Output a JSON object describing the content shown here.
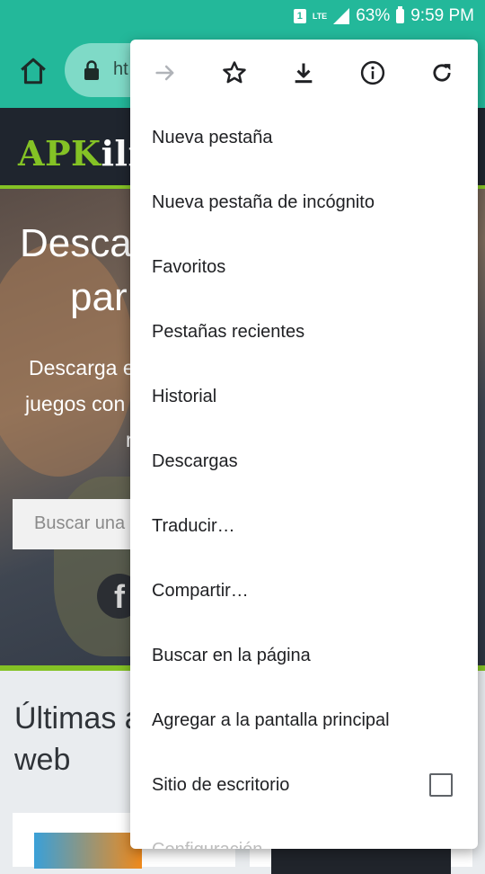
{
  "status_bar": {
    "sim": "1",
    "network": "LTE",
    "battery": "63%",
    "time": "9:59 PM"
  },
  "toolbar": {
    "url_partial": "ht"
  },
  "site": {
    "logo_apk": "APK",
    "logo_rest": "ili",
    "hero_title_line1": "Desca",
    "hero_title_line2": "par",
    "hero_sub_line1": "Descarga e",
    "hero_sub_line2": "juegos con",
    "hero_sub_line3": "r",
    "search_placeholder": "Buscar una",
    "facebook_letter": "f",
    "latest_line1": "Últimas a",
    "latest_line2": "web"
  },
  "menu": {
    "icon_row": [
      "forward-icon",
      "star-icon",
      "download-icon",
      "info-icon",
      "refresh-icon"
    ],
    "items": [
      {
        "label": "Nueva pestaña"
      },
      {
        "label": "Nueva pestaña de incógnito"
      },
      {
        "label": "Favoritos"
      },
      {
        "label": "Pestañas recientes"
      },
      {
        "label": "Historial"
      },
      {
        "label": "Descargas"
      },
      {
        "label": "Traducir…"
      },
      {
        "label": "Compartir…"
      },
      {
        "label": "Buscar en la página"
      },
      {
        "label": "Agregar a la pantalla principal"
      },
      {
        "label": "Sitio de escritorio",
        "checked": false
      },
      {
        "label": "Configuración"
      }
    ]
  },
  "colors": {
    "toolbar": "#23b89a",
    "site_accent": "#84c225",
    "menu_text": "#202124"
  }
}
